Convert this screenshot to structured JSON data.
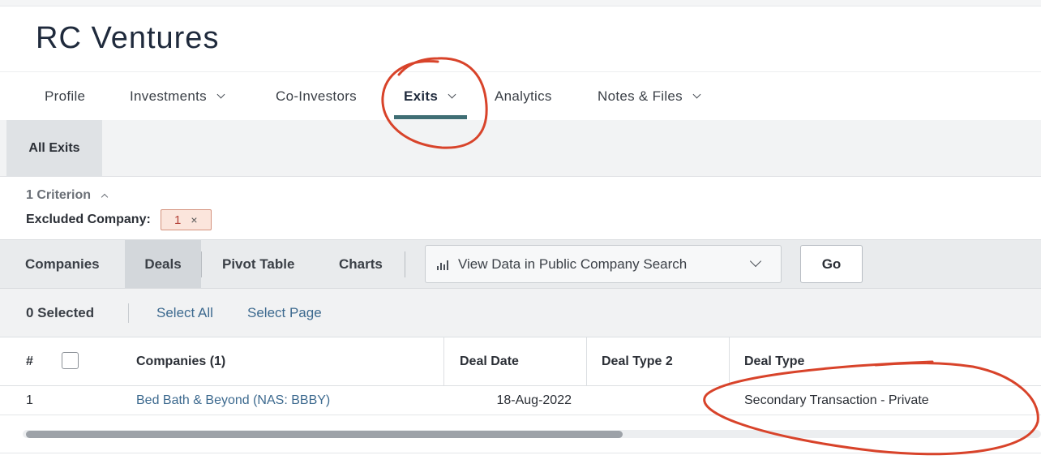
{
  "page": {
    "title": "RC Ventures"
  },
  "nav": {
    "tabs": [
      {
        "label": "Profile",
        "has_menu": false
      },
      {
        "label": "Investments",
        "has_menu": true
      },
      {
        "label": "Co-Investors",
        "has_menu": false
      },
      {
        "label": "Exits",
        "has_menu": true,
        "active": true
      },
      {
        "label": "Analytics",
        "has_menu": false
      },
      {
        "label": "Notes & Files",
        "has_menu": true
      }
    ]
  },
  "subtabs": {
    "active_label": "All Exits"
  },
  "criteria": {
    "header": "1 Criterion",
    "label": "Excluded Company:",
    "chip_value": "1",
    "chip_close": "×"
  },
  "views": {
    "tabs": [
      {
        "label": "Companies"
      },
      {
        "label": "Deals",
        "active": true
      },
      {
        "label": "Pivot Table"
      },
      {
        "label": "Charts"
      }
    ],
    "dropdown_label": "View Data in Public Company Search",
    "go_label": "Go"
  },
  "selection": {
    "count_label": "0 Selected",
    "select_all": "Select All",
    "select_page": "Select Page"
  },
  "table": {
    "headers": {
      "index": "#",
      "companies": "Companies (1)",
      "deal_date": "Deal Date",
      "deal_type_2": "Deal Type 2",
      "deal_type": "Deal Type"
    },
    "rows": [
      {
        "index": "1",
        "company": "Bed Bath & Beyond (NAS: BBBY)",
        "deal_date": "18-Aug-2022",
        "deal_type_2": "",
        "deal_type": "Secondary Transaction - Private"
      }
    ]
  },
  "annotation": {
    "color": "#d8432a"
  }
}
